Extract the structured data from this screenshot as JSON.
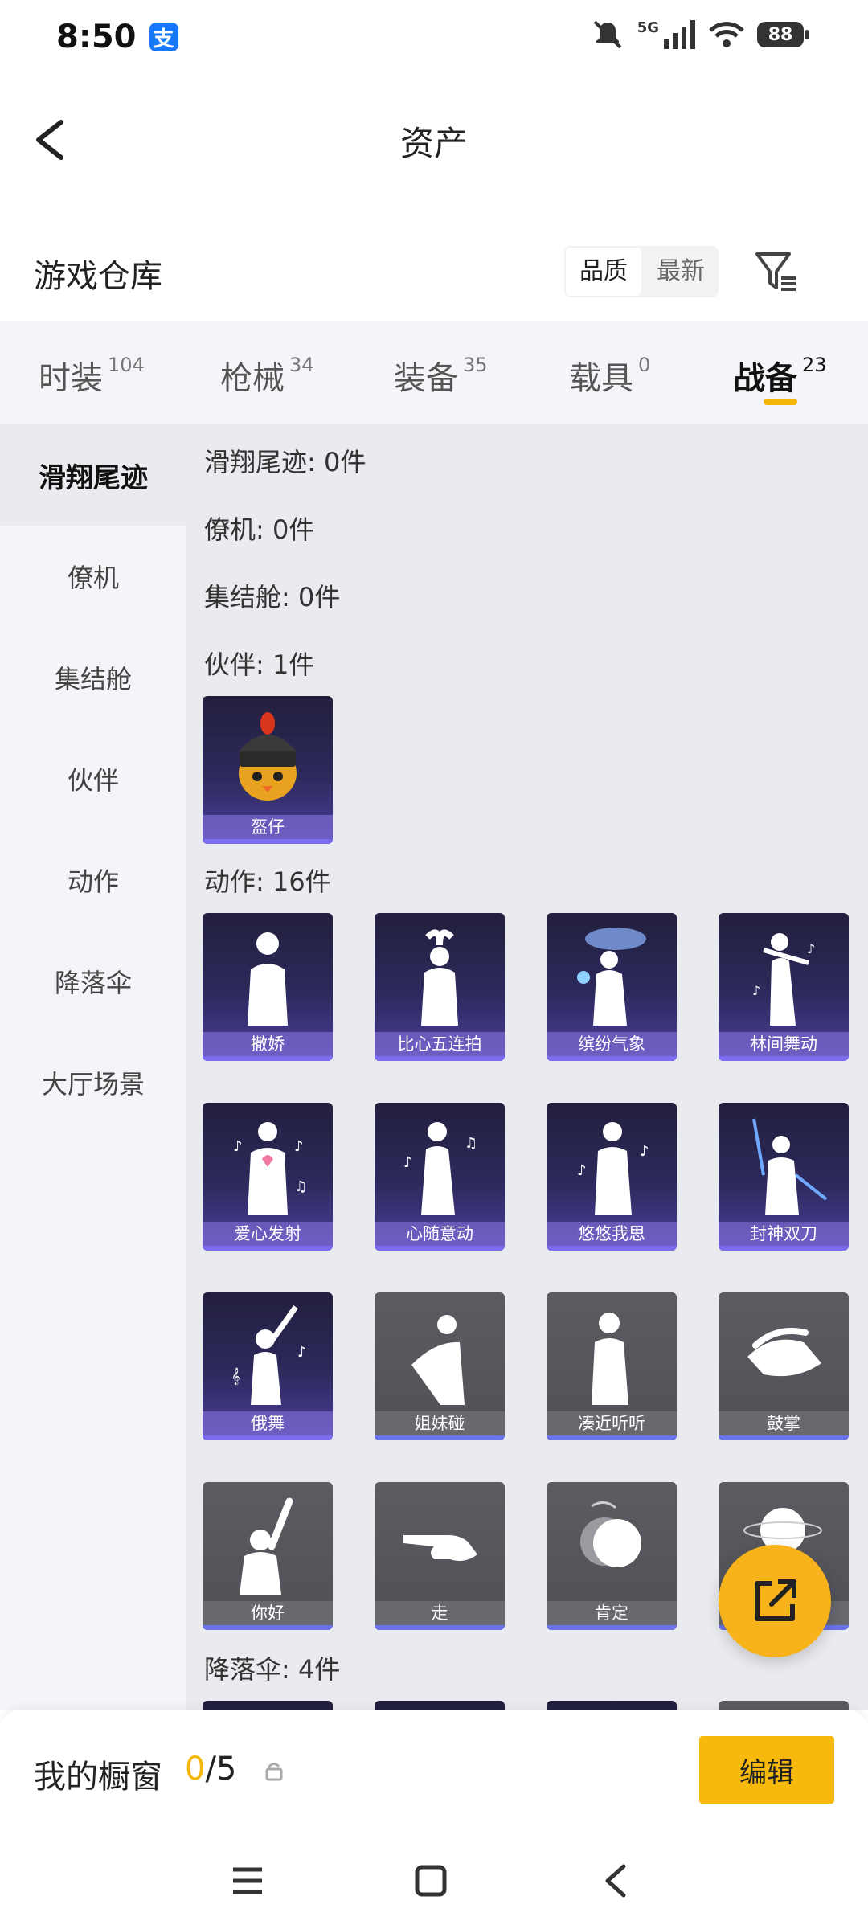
{
  "status_bar": {
    "time": "8:50",
    "alipay_icon": "alipay-icon",
    "network": "5G",
    "battery": "88"
  },
  "header": {
    "title": "资产",
    "back_icon": "back-arrow-icon"
  },
  "warehouse": {
    "title": "游戏仓库",
    "sort_options": [
      "品质",
      "最新"
    ],
    "sort_selected": "品质",
    "filter_icon": "filter-icon"
  },
  "tabs": [
    {
      "label": "时装",
      "count": "104"
    },
    {
      "label": "枪械",
      "count": "34"
    },
    {
      "label": "装备",
      "count": "35"
    },
    {
      "label": "载具",
      "count": "0"
    },
    {
      "label": "战备",
      "count": "23",
      "active": true
    }
  ],
  "sidebar": {
    "items": [
      {
        "label": "滑翔尾迹",
        "active": true
      },
      {
        "label": "僚机"
      },
      {
        "label": "集结舱"
      },
      {
        "label": "伙伴"
      },
      {
        "label": "动作"
      },
      {
        "label": "降落伞"
      },
      {
        "label": "大厅场景"
      }
    ]
  },
  "sections": {
    "glide_trail": "滑翔尾迹: 0件",
    "wingman": "僚机: 0件",
    "rally_pod": "集结舱: 0件",
    "partner": "伙伴: 1件",
    "actions": "动作: 16件",
    "parachute": "降落伞: 4件"
  },
  "partner_items": [
    {
      "name": "盔仔",
      "style": "purple"
    }
  ],
  "action_items": [
    {
      "name": "撒娇",
      "style": "purple"
    },
    {
      "name": "比心五连拍",
      "style": "purple"
    },
    {
      "name": "缤纷气象",
      "style": "purple"
    },
    {
      "name": "林间舞动",
      "style": "purple"
    },
    {
      "name": "爱心发射",
      "style": "purple"
    },
    {
      "name": "心随意动",
      "style": "purple"
    },
    {
      "name": "悠悠我思",
      "style": "purple"
    },
    {
      "name": "封神双刀",
      "style": "purple"
    },
    {
      "name": "俄舞",
      "style": "purple"
    },
    {
      "name": "姐妹碰",
      "style": "gray"
    },
    {
      "name": "凑近听听",
      "style": "gray"
    },
    {
      "name": "鼓掌",
      "style": "gray"
    },
    {
      "name": "你好",
      "style": "gray"
    },
    {
      "name": "走",
      "style": "gray"
    },
    {
      "name": "肯定",
      "style": "gray"
    },
    {
      "name": "",
      "style": "gray"
    }
  ],
  "showcase": {
    "label": "我的橱窗",
    "current": "0",
    "total": "/5",
    "edit_label": "编辑"
  },
  "colors": {
    "accent": "#f5b60a",
    "purple_card": "#2d2a5d",
    "gray_card": "#55565c"
  }
}
